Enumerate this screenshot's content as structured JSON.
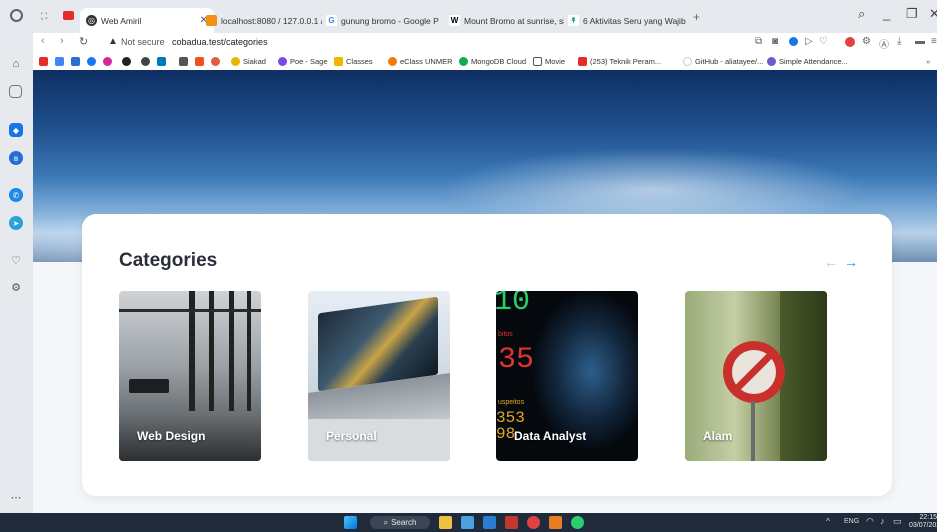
{
  "browser": {
    "tabs": [
      {
        "label": "Web Amiril",
        "active": true
      },
      {
        "label": "localhost:8080 / 127.0.0.1 /"
      },
      {
        "label": "gunung bromo - Google P"
      },
      {
        "label": "Mount Bromo at sunrise, sl"
      },
      {
        "label": "6 Aktivitas Seru yang Wajib"
      }
    ],
    "address": {
      "security": "Not secure",
      "url": "cobadua.test/categories"
    },
    "bookmarks": [
      {
        "label": "Siakad"
      },
      {
        "label": "Poe - Sage"
      },
      {
        "label": "Classes"
      },
      {
        "label": "eClass UNMER"
      },
      {
        "label": "MongoDB Cloud"
      },
      {
        "label": "Movie"
      },
      {
        "label": "(253) Teknik Peram..."
      },
      {
        "label": "GitHub - aliatayee/..."
      },
      {
        "label": "Simple Attendance..."
      }
    ]
  },
  "page": {
    "section_title": "Categories",
    "arrows": {
      "prev": "←",
      "next": "→"
    },
    "categories": [
      {
        "label": "Web Design"
      },
      {
        "label": "Personal"
      },
      {
        "label": "Data Analyst"
      },
      {
        "label": "Alam"
      }
    ],
    "data_analyst_art": {
      "n1": "10",
      "n2": "35",
      "n3": "98",
      "n4": "353",
      "w1": "bitos",
      "w2": "uspeitos"
    }
  },
  "taskbar": {
    "search_label": "Search",
    "lang": "ENG",
    "time": "22:15",
    "date": "03/07/2023"
  }
}
